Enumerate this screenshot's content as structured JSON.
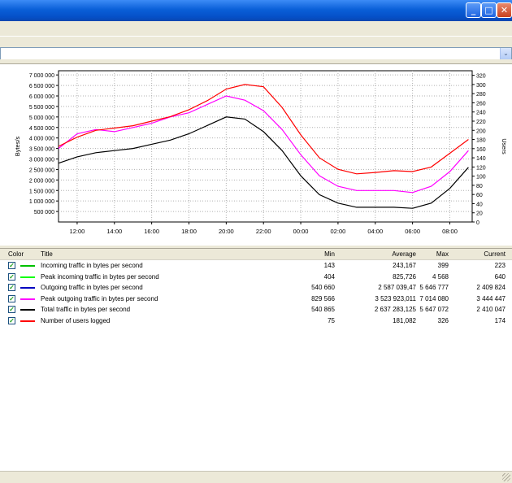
{
  "window": {
    "minimize_label": "_",
    "maximize_label": "□",
    "close_label": "✕",
    "min_icon": "minimize-icon",
    "max_icon": "maximize-icon",
    "close_icon": "close-icon"
  },
  "combo": {
    "arrow": "⌄"
  },
  "chart_data": {
    "type": "line",
    "ylabel": "Bytes/s",
    "y2label": "Users",
    "ylim": [
      0,
      7200000
    ],
    "y2lim": [
      0,
      330
    ],
    "y_ticks": [
      "7 000 000",
      "6 500 000",
      "6 000 000",
      "5 500 000",
      "5 000 000",
      "4 500 000",
      "4 000 000",
      "3 500 000",
      "3 000 000",
      "2 500 000",
      "2 000 000",
      "1 500 000",
      "1 000 000",
      "500 000"
    ],
    "y_tick_values": [
      7000000,
      6500000,
      6000000,
      5500000,
      5000000,
      4500000,
      4000000,
      3500000,
      3000000,
      2500000,
      2000000,
      1500000,
      1000000,
      500000
    ],
    "y2_ticks": [
      "320",
      "300",
      "280",
      "260",
      "240",
      "220",
      "200",
      "180",
      "160",
      "140",
      "120",
      "100",
      "80",
      "60",
      "40",
      "20",
      "0"
    ],
    "y2_tick_values": [
      320,
      300,
      280,
      260,
      240,
      220,
      200,
      180,
      160,
      140,
      120,
      100,
      80,
      60,
      40,
      20,
      0
    ],
    "x_ticks": [
      "12:00",
      "14:00",
      "16:00",
      "18:00",
      "20:00",
      "22:00",
      "00:00",
      "02:00",
      "04:00",
      "06:00",
      "08:00"
    ],
    "x_hours": [
      12,
      14,
      16,
      18,
      20,
      22,
      24,
      26,
      28,
      30,
      32
    ],
    "xlim": [
      11.0,
      33.2
    ],
    "grid": true,
    "series": [
      {
        "name": "Peak outgoing traffic in bytes per second",
        "color": "#ff00ff",
        "axis": "left",
        "x": [
          11,
          12,
          13,
          14,
          15,
          16,
          17,
          18,
          19,
          20,
          21,
          22,
          23,
          24,
          25,
          26,
          27,
          28,
          29,
          30,
          31,
          32,
          33
        ],
        "y": [
          3500000,
          4200000,
          4400000,
          4300000,
          4500000,
          4700000,
          5000000,
          5200000,
          5600000,
          6000000,
          5800000,
          5300000,
          4400000,
          3200000,
          2200000,
          1700000,
          1500000,
          1500000,
          1500000,
          1400000,
          1700000,
          2400000,
          3400000
        ]
      },
      {
        "name": "Total traffic in bytes per second",
        "color": "#000000",
        "axis": "left",
        "x": [
          11,
          12,
          13,
          14,
          15,
          16,
          17,
          18,
          19,
          20,
          21,
          22,
          23,
          24,
          25,
          26,
          27,
          28,
          29,
          30,
          31,
          32,
          33
        ],
        "y": [
          2800000,
          3100000,
          3300000,
          3400000,
          3500000,
          3700000,
          3900000,
          4200000,
          4600000,
          5000000,
          4900000,
          4300000,
          3400000,
          2200000,
          1300000,
          900000,
          700000,
          700000,
          700000,
          650000,
          900000,
          1600000,
          2600000
        ]
      },
      {
        "name": "Number of users logged",
        "color": "#ff0000",
        "axis": "right",
        "x": [
          11,
          12,
          13,
          14,
          15,
          16,
          17,
          18,
          19,
          20,
          21,
          22,
          23,
          24,
          25,
          26,
          27,
          28,
          29,
          30,
          31,
          32,
          33
        ],
        "y": [
          165,
          185,
          200,
          205,
          210,
          220,
          230,
          245,
          265,
          290,
          300,
          295,
          250,
          190,
          140,
          115,
          105,
          108,
          112,
          110,
          120,
          150,
          180
        ]
      }
    ]
  },
  "table": {
    "headers": {
      "color": "Color",
      "title": "Title",
      "min": "Min",
      "average": "Average",
      "max": "Max",
      "current": "Current"
    },
    "rows": [
      {
        "checked": "✓",
        "color": "#00c000",
        "title": "Incoming traffic in bytes per second",
        "min": "143",
        "average": "243,167",
        "max": "399",
        "current": "223"
      },
      {
        "checked": "✓",
        "color": "#00ff00",
        "title": "Peak incoming traffic in bytes per second",
        "min": "404",
        "average": "825,726",
        "max": "4 568",
        "current": "640"
      },
      {
        "checked": "✓",
        "color": "#0000c0",
        "title": "Outgoing traffic in bytes per second",
        "min": "540 660",
        "average": "2 587 039,47",
        "max": "5 646 777",
        "current": "2 409 824"
      },
      {
        "checked": "✓",
        "color": "#ff00ff",
        "title": "Peak outgoing traffic in bytes per second",
        "min": "829 566",
        "average": "3 523 923,011",
        "max": "7 014 080",
        "current": "3 444 447"
      },
      {
        "checked": "✓",
        "color": "#000000",
        "title": "Total traffic in bytes per second",
        "min": "540 865",
        "average": "2 637 283,125",
        "max": "5 647 072",
        "current": "2 410 047"
      },
      {
        "checked": "✓",
        "color": "#ff0000",
        "title": "Number of users logged",
        "min": "75",
        "average": "181,082",
        "max": "326",
        "current": "174"
      }
    ]
  }
}
